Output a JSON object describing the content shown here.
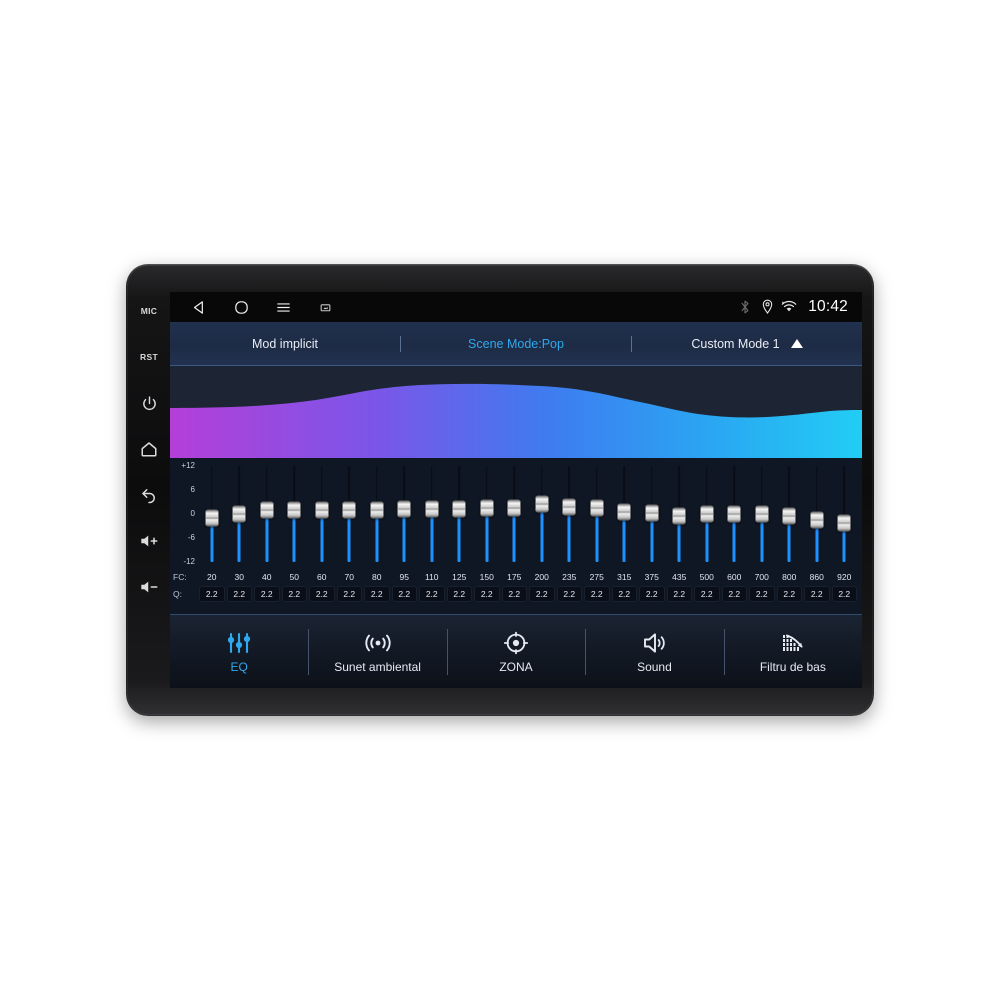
{
  "device": {
    "hardkeys": [
      {
        "name": "mic-key",
        "label": "MIC"
      },
      {
        "name": "reset-key",
        "label": "RST"
      },
      {
        "name": "power-key",
        "label": ""
      },
      {
        "name": "home-key",
        "label": ""
      },
      {
        "name": "back-key",
        "label": ""
      },
      {
        "name": "volume-up-key",
        "label": ""
      },
      {
        "name": "volume-down-key",
        "label": ""
      }
    ]
  },
  "statusbar": {
    "back_label": "back",
    "home_label": "home",
    "menu_label": "menu",
    "screenshot_label": "screenshot",
    "bluetooth_label": "bluetooth",
    "location_label": "location",
    "wifi_label": "wifi",
    "clock": "10:42"
  },
  "modebar": {
    "left_label": "Mod implicit",
    "center_label": "Scene Mode:Pop",
    "right_label": "Custom Mode 1",
    "expand_label": "expand",
    "active_color": "#2fa8ee"
  },
  "visualizer": {
    "gradient_start": "#b43fd8",
    "gradient_mid": "#4a6ef0",
    "gradient_end": "#22c7f2",
    "background": "#1d2433"
  },
  "equalizer": {
    "scale_labels": [
      "+12",
      "6",
      "0",
      "-6",
      "-12"
    ],
    "fc_row_label": "FC:",
    "q_row_label": "Q:",
    "gain_min": -12,
    "gain_max": 12,
    "track_color": "#1e90ff",
    "bands": [
      {
        "fc": "20",
        "q": "2.2",
        "gain": -0.9
      },
      {
        "fc": "30",
        "q": "2.2",
        "gain": 0.0
      },
      {
        "fc": "40",
        "q": "2.2",
        "gain": 0.9
      },
      {
        "fc": "50",
        "q": "2.2",
        "gain": 0.9
      },
      {
        "fc": "60",
        "q": "2.2",
        "gain": 0.9
      },
      {
        "fc": "70",
        "q": "2.2",
        "gain": 0.9
      },
      {
        "fc": "80",
        "q": "2.2",
        "gain": 1.1
      },
      {
        "fc": "95",
        "q": "2.2",
        "gain": 1.2
      },
      {
        "fc": "110",
        "q": "2.2",
        "gain": 1.2
      },
      {
        "fc": "125",
        "q": "2.2",
        "gain": 1.3
      },
      {
        "fc": "150",
        "q": "2.2",
        "gain": 1.5
      },
      {
        "fc": "175",
        "q": "2.2",
        "gain": 1.6
      },
      {
        "fc": "200",
        "q": "2.2",
        "gain": 2.4
      },
      {
        "fc": "235",
        "q": "2.2",
        "gain": 1.7
      },
      {
        "fc": "275",
        "q": "2.2",
        "gain": 1.4
      },
      {
        "fc": "315",
        "q": "2.2",
        "gain": 0.5
      },
      {
        "fc": "375",
        "q": "2.2",
        "gain": 0.2
      },
      {
        "fc": "435",
        "q": "2.2",
        "gain": -0.5
      },
      {
        "fc": "500",
        "q": "2.2",
        "gain": 0.1
      },
      {
        "fc": "600",
        "q": "2.2",
        "gain": 0.0
      },
      {
        "fc": "700",
        "q": "2.2",
        "gain": 0.1
      },
      {
        "fc": "800",
        "q": "2.2",
        "gain": -0.5
      },
      {
        "fc": "860",
        "q": "2.2",
        "gain": -1.6
      },
      {
        "fc": "920",
        "q": "2.2",
        "gain": -2.3
      }
    ]
  },
  "tabs": [
    {
      "id": "eq",
      "label": "EQ",
      "icon": "equalizer-sliders-icon",
      "active": true
    },
    {
      "id": "ambient",
      "label": "Sunet ambiental",
      "icon": "surround-waves-icon",
      "active": false
    },
    {
      "id": "zona",
      "label": "ZONA",
      "icon": "zone-target-icon",
      "active": false
    },
    {
      "id": "sound",
      "label": "Sound",
      "icon": "speaker-icon",
      "active": false
    },
    {
      "id": "bassfilter",
      "label": "Filtru de bas",
      "icon": "bass-filter-icon",
      "active": false
    }
  ]
}
